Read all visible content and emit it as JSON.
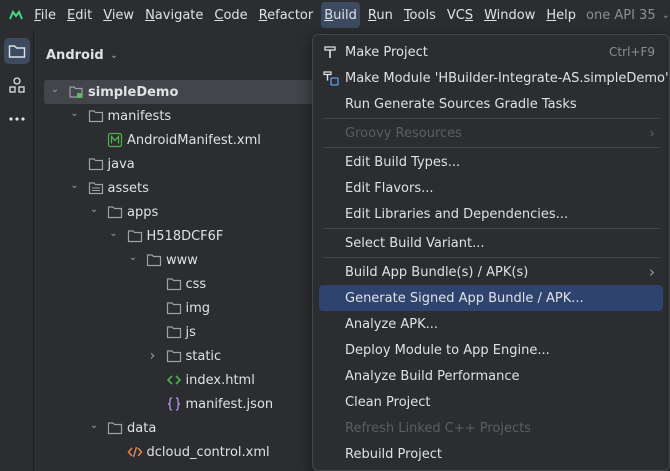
{
  "menubar": {
    "items": [
      {
        "label": "File",
        "mnemonic": "F",
        "rest": "ile"
      },
      {
        "label": "Edit",
        "mnemonic": "E",
        "rest": "dit"
      },
      {
        "label": "View",
        "mnemonic": "V",
        "rest": "iew"
      },
      {
        "label": "Navigate",
        "mnemonic": "N",
        "rest": "avigate"
      },
      {
        "label": "Code",
        "mnemonic": "C",
        "rest": "ode"
      },
      {
        "label": "Refactor",
        "mnemonic": "R",
        "rest": "efactor"
      },
      {
        "label": "Build",
        "mnemonic": "B",
        "rest": "uild"
      },
      {
        "label": "Run",
        "mnemonic": "R",
        "rest": "un"
      },
      {
        "label": "Tools",
        "mnemonic": "T",
        "rest": "ools"
      },
      {
        "label": "VCS",
        "mnemonic": "S",
        "rest": ""
      },
      {
        "label": "Window",
        "mnemonic": "W",
        "rest": "indow"
      },
      {
        "label": "Help",
        "mnemonic": "H",
        "rest": "elp"
      }
    ],
    "run_config": "one API 35"
  },
  "panel": {
    "title": "Android"
  },
  "tree": [
    {
      "label": "simpleDemo",
      "depth": 0,
      "arrow": "down",
      "icon": "module-icon",
      "bold": true,
      "selected": true
    },
    {
      "label": "manifests",
      "depth": 1,
      "arrow": "down",
      "icon": "folder-icon"
    },
    {
      "label": "AndroidManifest.xml",
      "depth": 2,
      "arrow": "",
      "icon": "manifest-file-icon"
    },
    {
      "label": "java",
      "depth": 1,
      "arrow": "",
      "icon": "folder-icon"
    },
    {
      "label": "assets",
      "depth": 1,
      "arrow": "down",
      "icon": "assets-folder-icon"
    },
    {
      "label": "apps",
      "depth": 2,
      "arrow": "down",
      "icon": "folder-icon"
    },
    {
      "label": "H518DCF6F",
      "depth": 3,
      "arrow": "down",
      "icon": "folder-icon"
    },
    {
      "label": "www",
      "depth": 4,
      "arrow": "down",
      "icon": "folder-icon"
    },
    {
      "label": "css",
      "depth": 5,
      "arrow": "",
      "icon": "folder-icon"
    },
    {
      "label": "img",
      "depth": 5,
      "arrow": "",
      "icon": "folder-icon"
    },
    {
      "label": "js",
      "depth": 5,
      "arrow": "",
      "icon": "folder-icon"
    },
    {
      "label": "static",
      "depth": 5,
      "arrow": "right",
      "icon": "folder-icon"
    },
    {
      "label": "index.html",
      "depth": 5,
      "arrow": "",
      "icon": "html-file-icon"
    },
    {
      "label": "manifest.json",
      "depth": 5,
      "arrow": "",
      "icon": "json-file-icon"
    },
    {
      "label": "data",
      "depth": 2,
      "arrow": "down",
      "icon": "folder-icon"
    },
    {
      "label": "dcloud_control.xml",
      "depth": 3,
      "arrow": "",
      "icon": "xml-file-icon"
    }
  ],
  "build_menu": [
    {
      "type": "item",
      "label": "Make Project",
      "icon": "hammer-icon",
      "shortcut": "Ctrl+F9"
    },
    {
      "type": "item",
      "label": "Make Module 'HBuilder-Integrate-AS.simpleDemo'",
      "icon": "make-module-icon"
    },
    {
      "type": "item",
      "label": "Run Generate Sources Gradle Tasks"
    },
    {
      "type": "sep"
    },
    {
      "type": "item",
      "label": "Groovy Resources",
      "disabled": true,
      "submenu": true
    },
    {
      "type": "sep"
    },
    {
      "type": "item",
      "label": "Edit Build Types..."
    },
    {
      "type": "item",
      "label": "Edit Flavors..."
    },
    {
      "type": "item",
      "label": "Edit Libraries and Dependencies..."
    },
    {
      "type": "sep"
    },
    {
      "type": "item",
      "label": "Select Build Variant..."
    },
    {
      "type": "sep"
    },
    {
      "type": "item",
      "label": "Build App Bundle(s) / APK(s)",
      "submenu": true
    },
    {
      "type": "item",
      "label": "Generate Signed App Bundle / APK...",
      "highlight": true
    },
    {
      "type": "item",
      "label": "Analyze APK..."
    },
    {
      "type": "item",
      "label": "Deploy Module to App Engine..."
    },
    {
      "type": "item",
      "label": "Analyze Build Performance"
    },
    {
      "type": "item",
      "label": "Clean Project"
    },
    {
      "type": "item",
      "label": "Refresh Linked C++ Projects",
      "disabled": true
    },
    {
      "type": "item",
      "label": "Rebuild Project"
    }
  ],
  "colors": {
    "background": "#1e1f22",
    "panel": "#2b2d30",
    "highlight": "#2e436e",
    "selected": "#43454a",
    "folder": "#9da0a6",
    "module_green": "#5fb865",
    "html_green": "#4fb14f",
    "json_purple": "#b38adb",
    "xml_orange": "#e08855"
  }
}
